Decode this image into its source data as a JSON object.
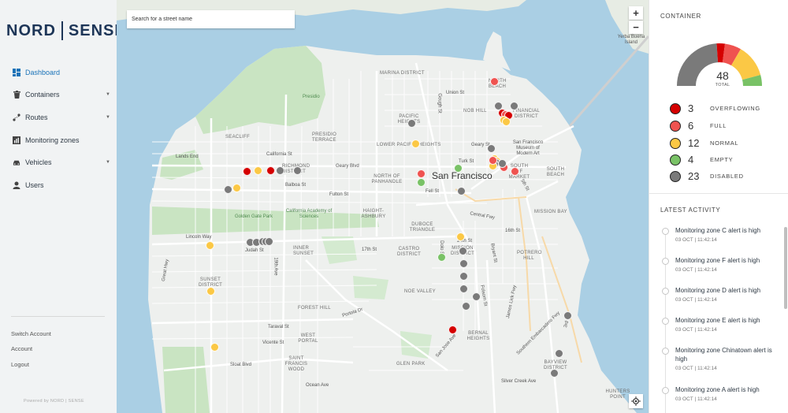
{
  "brand": {
    "left": "NORD",
    "right": "SENSE"
  },
  "nav": [
    {
      "label": "Dashboard",
      "active": true,
      "has_caret": false,
      "icon": "dashboard-icon"
    },
    {
      "label": "Containers",
      "active": false,
      "has_caret": true,
      "icon": "trash-icon"
    },
    {
      "label": "Routes",
      "active": false,
      "has_caret": true,
      "icon": "route-icon"
    },
    {
      "label": "Monitoring zones",
      "active": false,
      "has_caret": false,
      "icon": "bar-chart-icon"
    },
    {
      "label": "Vehicles",
      "active": false,
      "has_caret": true,
      "icon": "car-icon"
    },
    {
      "label": "Users",
      "active": false,
      "has_caret": false,
      "icon": "user-icon"
    }
  ],
  "footer": {
    "links": [
      "Switch Account",
      "Account",
      "Logout"
    ],
    "powered_by": "Powered by NORD | SENSE"
  },
  "map": {
    "search_placeholder": "Search for a street name",
    "zoom_in": "+",
    "zoom_out": "−",
    "city_label": "San Francisco",
    "district_labels": [
      "MARINA DISTRICT",
      "NORTH BEACH",
      "NOB HILL",
      "FINANCIAL DISTRICT",
      "PACIFIC HEIGHTS",
      "PRESIDIO TERRACE",
      "LOWER PACIFIC HEIGHTS",
      "SOUTH OF MARKET",
      "SOUTH BEACH",
      "NORTH OF PANHANDLE",
      "HAIGHT-ASHBURY",
      "DUBOCE TRIANGLE",
      "CASTRO DISTRICT",
      "MISSION DISTRICT",
      "POTRERO HILL",
      "INNER SUNSET",
      "SUNSET DISTRICT",
      "NOE VALLEY",
      "FOREST HILL",
      "WEST PORTAL",
      "BERNAL HEIGHTS",
      "SAINT FRANCIS WOOD",
      "GLEN PARK",
      "BAYVIEW DISTRICT",
      "HUNTERS POINT",
      "MISSION BAY",
      "RICHMOND DISTRICT",
      "SEACLIFF",
      "Lands End",
      "Yerba Buena Island",
      "Presidio",
      "Golden Gate Park",
      "California Academy of Sciences",
      "San Francisco Museum of Modern Art"
    ],
    "street_labels": [
      "California St",
      "Geary Blvd",
      "Balboa St",
      "Fulton St",
      "Lincoln Way",
      "Judah St",
      "Taraval St",
      "Vicente St",
      "Sloat Blvd",
      "Great Hwy",
      "19th Ave",
      "Union St",
      "Gough St",
      "Turk St",
      "Geary St",
      "Fell St",
      "Central Fwy",
      "5th St",
      "16th St",
      "17th St",
      "24th St",
      "Dolo St",
      "Folsom St",
      "Bryant St",
      "James Lick Fwy",
      "Portola Dr",
      "San Jose Ave",
      "Southern Embarcadero Fwy",
      "3rd St",
      "Ocean Ave",
      "Silver Creek Ave"
    ],
    "marker_statuses": [
      "full",
      "overflowing",
      "full",
      "overflowing",
      "normal",
      "normal",
      "disabled",
      "disabled",
      "disabled",
      "normal",
      "disabled",
      "normal",
      "normal",
      "disabled",
      "disabled",
      "full",
      "normal",
      "overflowing",
      "full",
      "full",
      "empty",
      "disabled",
      "disabled",
      "disabled",
      "disabled",
      "normal",
      "disabled",
      "disabled",
      "empty",
      "overflowing",
      "normal",
      "overflowing",
      "disabled",
      "disabled",
      "disabled",
      "disabled",
      "disabled",
      "disabled",
      "normal",
      "normal",
      "empty",
      "disabled",
      "disabled",
      "disabled",
      "disabled",
      "full",
      "disabled",
      "disabled",
      "disabled",
      "normal",
      "normal"
    ]
  },
  "container": {
    "title": "CONTAINER",
    "total": 48,
    "total_label": "TOTAL",
    "statuses": [
      {
        "key": "overflowing",
        "count": 3,
        "label": "OVERFLOWING",
        "color": "#d50000"
      },
      {
        "key": "full",
        "count": 6,
        "label": "FULL",
        "color": "#ef5350"
      },
      {
        "key": "normal",
        "count": 12,
        "label": "NORMAL",
        "color": "#fbc845"
      },
      {
        "key": "empty",
        "count": 4,
        "label": "EMPTY",
        "color": "#79c266"
      },
      {
        "key": "disabled",
        "count": 23,
        "label": "DISABLED",
        "color": "#7a7a7a"
      }
    ]
  },
  "activity": {
    "title": "LATEST ACTIVITY",
    "items": [
      {
        "text": "Monitoring zone C alert is high",
        "time": "03 OCT | 11:42:14"
      },
      {
        "text": "Monitoring zone F alert is high",
        "time": "03 OCT | 11:42:14"
      },
      {
        "text": "Monitoring zone D alert is high",
        "time": "03 OCT | 11:42:14"
      },
      {
        "text": "Monitoring zone E alert is high",
        "time": "03 OCT | 11:42:14"
      },
      {
        "text": "Monitoring zone Chinatown alert is high",
        "time": "03 OCT | 11:42:14"
      },
      {
        "text": "Monitoring zone A alert is high",
        "time": "03 OCT | 11:42:14"
      }
    ]
  }
}
